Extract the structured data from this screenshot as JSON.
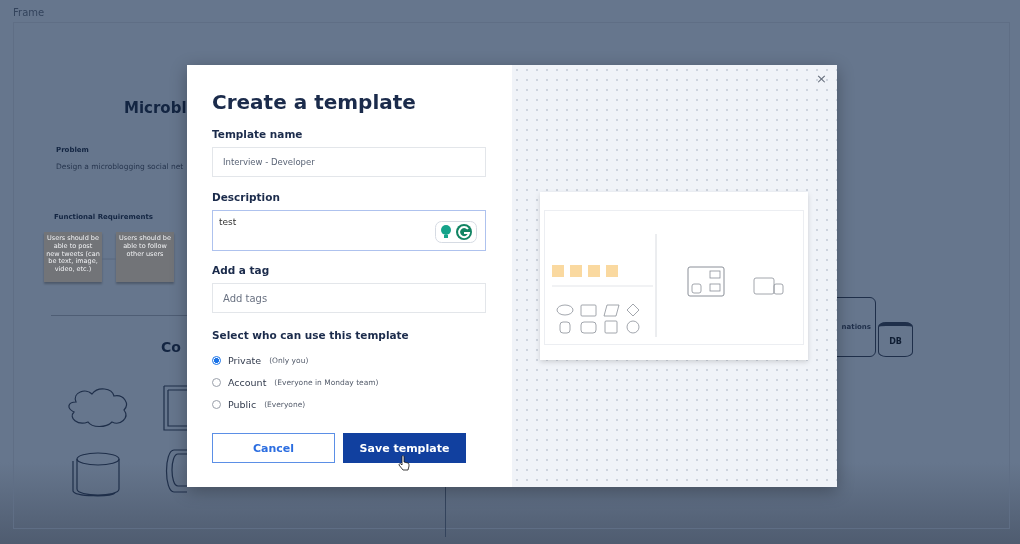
{
  "canvas": {
    "frame_label": "Frame",
    "title": "Microbl",
    "problem_heading": "Problem",
    "problem_text": "Design a microblogging social net",
    "requirements_heading": "Functional Requirements",
    "sticky_notes": [
      "Users should be able to post new tweets (can be text, image, video, etc.)",
      "Users should be able to follow other users"
    ],
    "section_title": "Co",
    "node_label": "nations",
    "db_label": "DB"
  },
  "dialog": {
    "title": "Create a template",
    "close": "×",
    "name_label": "Template name",
    "name_value": "Interview - Developer",
    "description_label": "Description",
    "description_value": "test",
    "tag_label": "Add a tag",
    "tag_placeholder": "Add tags",
    "audience_label": "Select who can use this template",
    "options": [
      {
        "label": "Private",
        "hint": "(Only you)",
        "selected": true
      },
      {
        "label": "Account",
        "hint": "(Everyone in Monday team)",
        "selected": false
      },
      {
        "label": "Public",
        "hint": "(Everyone)",
        "selected": false
      }
    ],
    "buttons": [
      {
        "label": "Cancel",
        "kind": "secondary"
      },
      {
        "label": "Save template",
        "kind": "primary"
      }
    ]
  }
}
